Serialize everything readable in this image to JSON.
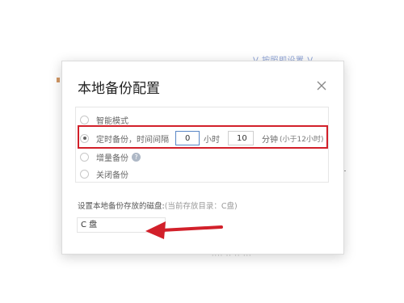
{
  "background": {
    "faint_text": "ᐯ 按照即设置 ᐯ",
    "bottom_text": "···· ·· ·· ···"
  },
  "dialog": {
    "title": "本地备份配置",
    "close_icon": "close-icon"
  },
  "options": [
    {
      "label": "智能模式",
      "checked": false
    },
    {
      "label": "定时备份，时间间隔",
      "checked": true
    },
    {
      "label": "增量备份",
      "checked": false,
      "help_icon": "question-circle-icon",
      "help_glyph": "?"
    },
    {
      "label": "关闭备份",
      "checked": false
    }
  ],
  "schedule": {
    "hours_value": "0",
    "hours_unit": "小时",
    "minutes_value": "10",
    "minutes_unit": "分钟",
    "hint": "(小于12小时)"
  },
  "storage": {
    "label": "设置本地备份存放的磁盘:",
    "current": "(当前存放目录：C盘)",
    "selected_disk": "C 盘"
  },
  "colors": {
    "highlight_border": "#d2202a",
    "arrow": "#d2202a",
    "active_input_border": "#5a87c6"
  }
}
